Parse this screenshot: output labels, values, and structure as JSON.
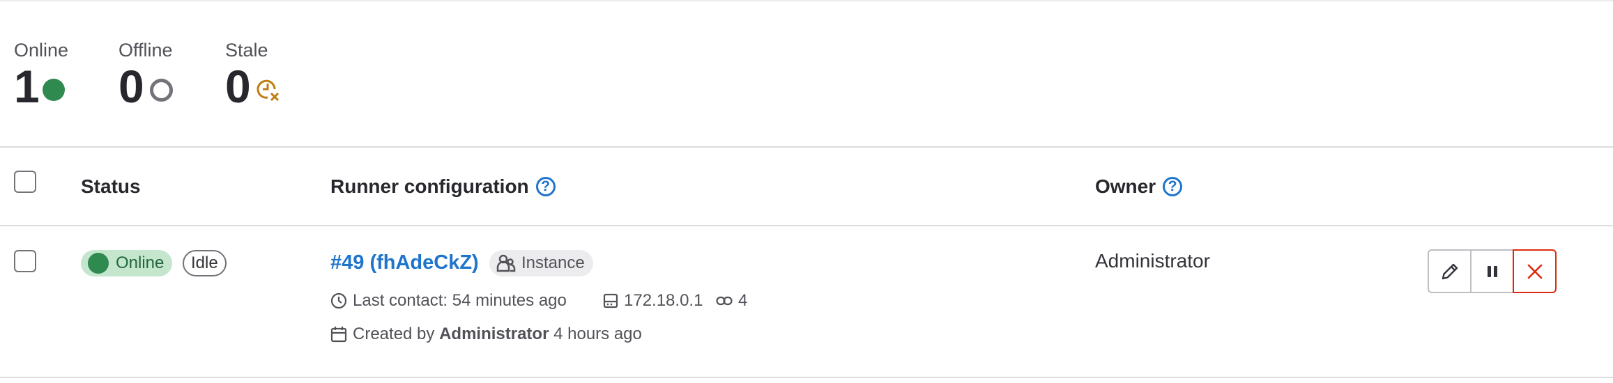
{
  "stats": {
    "online": {
      "label": "Online",
      "value": "1"
    },
    "offline": {
      "label": "Offline",
      "value": "0"
    },
    "stale": {
      "label": "Stale",
      "value": "0"
    }
  },
  "table": {
    "headers": {
      "status": "Status",
      "config": "Runner configuration",
      "owner": "Owner"
    },
    "rows": [
      {
        "status_badge": "Online",
        "idle_badge": "Idle",
        "runner_name": "#49 (fhAdeCkZ)",
        "type_badge": "Instance",
        "last_contact": "Last contact: 54 minutes ago",
        "ip": "172.18.0.1",
        "jobs": "4",
        "created_prefix": "Created by",
        "created_by": "Administrator",
        "created_when": "4 hours ago",
        "owner": "Administrator"
      }
    ]
  },
  "icons": [
    "online-dot-icon",
    "offline-ring-icon",
    "stale-clock-icon",
    "help-icon",
    "users-icon",
    "clock-icon",
    "ip-address-icon",
    "jobs-link-icon",
    "calendar-icon",
    "pencil-icon",
    "pause-icon",
    "close-icon"
  ],
  "colors": {
    "online": "#2f8a4f",
    "stale": "#c17d10",
    "link": "#1f75cb",
    "danger": "#dd2b0e"
  }
}
